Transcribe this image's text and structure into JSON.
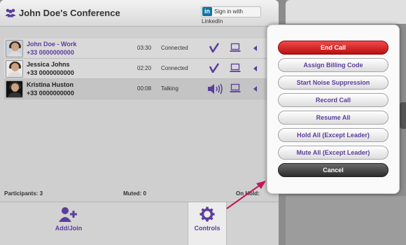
{
  "header": {
    "title": "John Doe's Conference",
    "conference_icon": "participants-icon",
    "linkedin": {
      "badge": "in",
      "label": "Sign in with LinkedIn"
    }
  },
  "participants": [
    {
      "name": "John Doe - Work",
      "number": "+33 0000000000",
      "duration": "03:30",
      "status": "Connected",
      "state_icon": "check-icon",
      "device_icon": "laptop-icon",
      "is_leader": true
    },
    {
      "name": "Jessica Johns",
      "number": "+33 0000000000",
      "duration": "02:20",
      "status": "Connected",
      "state_icon": "check-icon",
      "device_icon": "laptop-icon",
      "is_leader": false
    },
    {
      "name": "Kristina Huston",
      "number": "+33 0000000000",
      "duration": "00:08",
      "status": "Talking",
      "state_icon": "speaker-icon",
      "device_icon": "laptop-icon",
      "is_leader": false
    }
  ],
  "summary": {
    "participants": "Participants: 3",
    "muted": "Muted: 0",
    "on_hold": "On Hold:"
  },
  "toolbar": {
    "add_join": "Add/Join",
    "controls": "Controls"
  },
  "controls_menu": {
    "end_call": "End Call",
    "assign_billing": "Assign Billing Code",
    "noise_suppression": "Start Noise Suppression",
    "record_call": "Record Call",
    "resume_all": "Resume All",
    "hold_all": "Hold All (Except Leader)",
    "mute_all": "Mute All (Except Leader)",
    "cancel": "Cancel"
  },
  "colors": {
    "accent": "#5b3d9c",
    "end_call": "#d81e1e",
    "cancel": "#3a3a3a",
    "annotation_arrow": "#c2185b"
  }
}
